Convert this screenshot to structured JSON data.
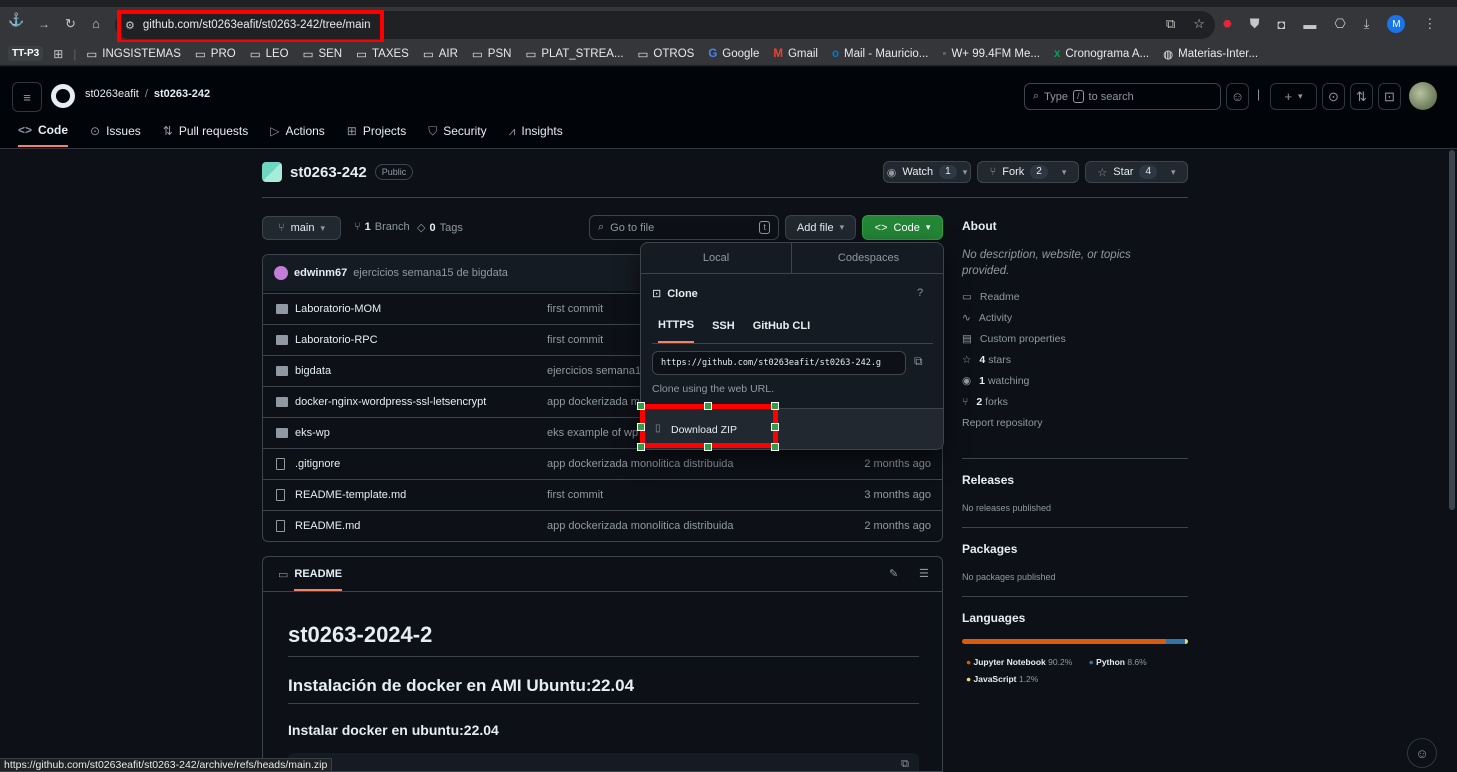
{
  "browser": {
    "url": "github.com/st0263eafit/st0263-242/tree/main",
    "status_url": "https://github.com/st0263eafit/st0263-242/archive/refs/heads/main.zip",
    "bookmarks": [
      {
        "icon": "TT-P3",
        "label": ""
      },
      {
        "icon": "folder-icon",
        "label": "INGSISTEMAS"
      },
      {
        "icon": "folder-icon",
        "label": "PRO"
      },
      {
        "icon": "folder-icon",
        "label": "LEO"
      },
      {
        "icon": "folder-icon",
        "label": "SEN"
      },
      {
        "icon": "folder-icon",
        "label": "TAXES"
      },
      {
        "icon": "folder-icon",
        "label": "AIR"
      },
      {
        "icon": "folder-icon",
        "label": "PSN"
      },
      {
        "icon": "folder-icon",
        "label": "PLAT_STREA..."
      },
      {
        "icon": "folder-icon",
        "label": "OTROS"
      },
      {
        "icon": "google-icon",
        "label": "Google"
      },
      {
        "icon": "gmail-icon",
        "label": "Gmail"
      },
      {
        "icon": "outlook-icon",
        "label": "Mail - Mauricio..."
      },
      {
        "icon": "radio-icon",
        "label": "W+ 99.4FM Me..."
      },
      {
        "icon": "sheets-icon",
        "label": "Cronograma A..."
      },
      {
        "icon": "globe-icon",
        "label": "Materias-Inter..."
      }
    ],
    "avatar_letter": "M"
  },
  "header": {
    "owner": "st0263eafit",
    "separator": "/",
    "repo": "st0263-242",
    "search_placeholder_pre": "Type",
    "search_key": "/",
    "search_placeholder_post": "to search",
    "nav": [
      {
        "label": "Code",
        "icon": "code-icon"
      },
      {
        "label": "Issues",
        "icon": "issue-icon"
      },
      {
        "label": "Pull requests",
        "icon": "pull-request-icon"
      },
      {
        "label": "Actions",
        "icon": "play-icon"
      },
      {
        "label": "Projects",
        "icon": "table-icon"
      },
      {
        "label": "Security",
        "icon": "shield-icon"
      },
      {
        "label": "Insights",
        "icon": "graph-icon"
      }
    ]
  },
  "repo": {
    "name": "st0263-242",
    "visibility": "Public",
    "watch_label": "Watch",
    "watch_count": "1",
    "fork_label": "Fork",
    "fork_count": "2",
    "star_label": "Star",
    "star_count": "4"
  },
  "toolbar": {
    "branch": "main",
    "branch_count": "1",
    "branch_label": "Branch",
    "tag_count": "0",
    "tag_label": "Tags",
    "goto_placeholder": "Go to file",
    "goto_key": "t",
    "add_file": "Add file",
    "code": "Code"
  },
  "commit": {
    "author": "edwinm67",
    "message": "ejercicios semana15 de bigdata"
  },
  "files": [
    {
      "type": "dir",
      "name": "Laboratorio-MOM",
      "msg": "first commit",
      "age": ""
    },
    {
      "type": "dir",
      "name": "Laboratorio-RPC",
      "msg": "first commit",
      "age": ""
    },
    {
      "type": "dir",
      "name": "bigdata",
      "msg": "ejercicios semana1",
      "age": ""
    },
    {
      "type": "dir",
      "name": "docker-nginx-wordpress-ssl-letsencrypt",
      "msg": "app dockerizada m",
      "age": ""
    },
    {
      "type": "dir",
      "name": "eks-wp",
      "msg": "eks example of wp",
      "age": ""
    },
    {
      "type": "file",
      "name": ".gitignore",
      "msg": "app dockerizada monolitica distribuida",
      "age": "2 months ago"
    },
    {
      "type": "file",
      "name": "README-template.md",
      "msg": "first commit",
      "age": "3 months ago"
    },
    {
      "type": "file",
      "name": "README.md",
      "msg": "app dockerizada monolitica distribuida",
      "age": "2 months ago"
    }
  ],
  "clone": {
    "tabs": [
      "Local",
      "Codespaces"
    ],
    "title": "Clone",
    "protocols": [
      "HTTPS",
      "SSH",
      "GitHub CLI"
    ],
    "url": "https://github.com/st0263eafit/st0263-242.g",
    "hint": "Clone using the web URL.",
    "download": "Download ZIP"
  },
  "about": {
    "title": "About",
    "description": "No description, website, or topics provided.",
    "items": [
      {
        "icon": "book-icon",
        "bold": "",
        "label": "Readme"
      },
      {
        "icon": "pulse-icon",
        "bold": "",
        "label": "Activity"
      },
      {
        "icon": "note-icon",
        "bold": "",
        "label": "Custom properties"
      },
      {
        "icon": "star-icon",
        "bold": "4",
        "label": "stars"
      },
      {
        "icon": "eye-icon",
        "bold": "1",
        "label": "watching"
      },
      {
        "icon": "fork-icon",
        "bold": "2",
        "label": "forks"
      }
    ],
    "report": "Report repository"
  },
  "releases": {
    "title": "Releases",
    "text": "No releases published"
  },
  "packages": {
    "title": "Packages",
    "text": "No packages published"
  },
  "languages": {
    "title": "Languages",
    "items": [
      {
        "name": "Jupyter Notebook",
        "pct": "90.2%",
        "value": 90.2,
        "color": "#da5b0b"
      },
      {
        "name": "Python",
        "pct": "8.6%",
        "value": 8.6,
        "color": "#3572a5"
      },
      {
        "name": "JavaScript",
        "pct": "1.2%",
        "value": 1.2,
        "color": "#f1e05a"
      }
    ]
  },
  "readme": {
    "tab": "README",
    "h1": "st0263-2024-2",
    "h2": "Instalación de docker en AMI Ubuntu:22.04",
    "h3": "Instalar docker en ubuntu:22.04"
  }
}
